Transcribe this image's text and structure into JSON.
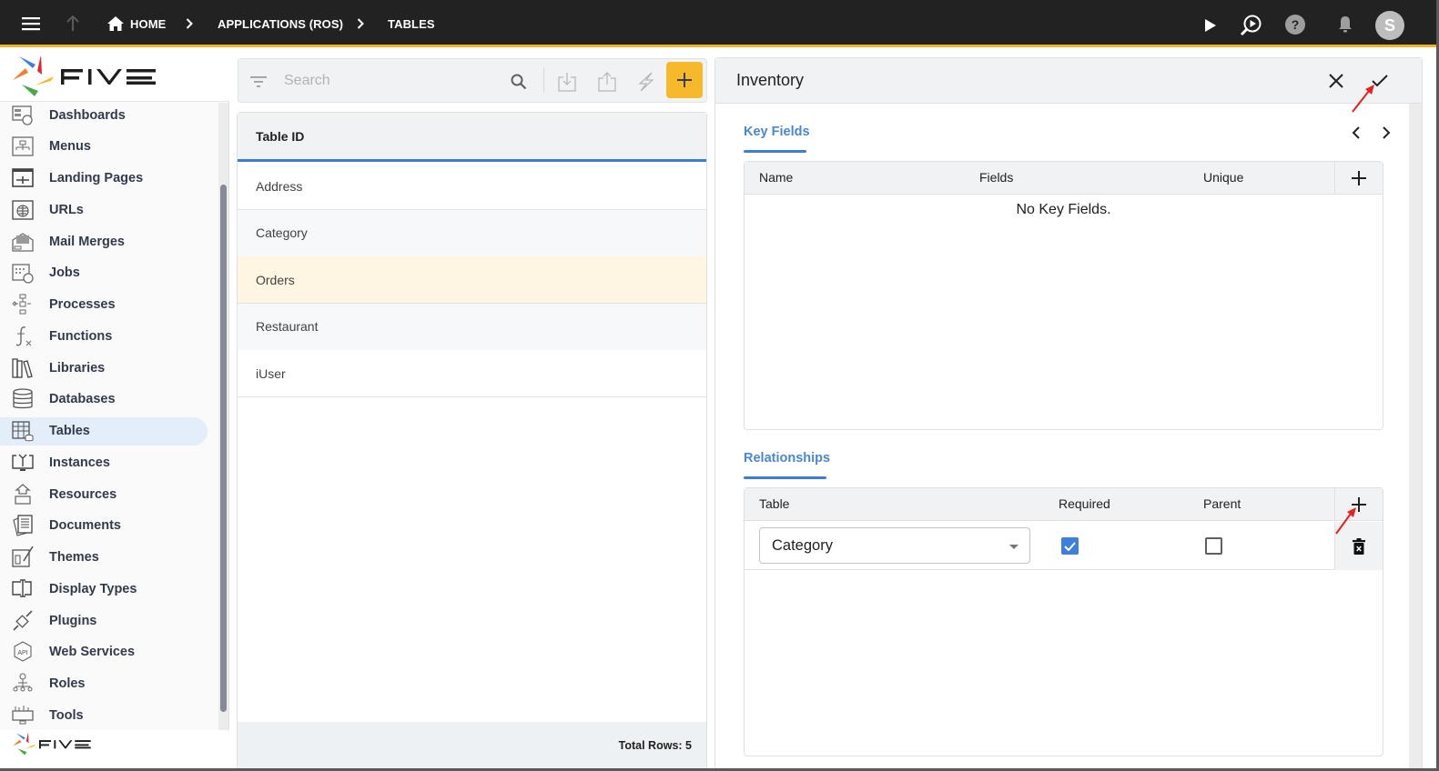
{
  "topbar": {
    "menu_icon": "hamburger-menu-icon",
    "up_icon": "arrow-up-icon",
    "breadcrumbs": [
      {
        "label": "HOME",
        "icon": "home-icon"
      },
      {
        "label": "APPLICATIONS (ROS)"
      },
      {
        "label": "TABLES"
      }
    ],
    "separator_glyph": "›",
    "actions": [
      {
        "name": "run",
        "icon": "play-icon"
      },
      {
        "name": "inspect",
        "icon": "search-play-icon"
      },
      {
        "name": "help",
        "icon": "help-circle-icon"
      },
      {
        "name": "notifications",
        "icon": "bell-icon"
      }
    ],
    "avatar_initial": "S",
    "accent_color": "#f0b323"
  },
  "brand": {
    "wordmark": "FIVE"
  },
  "sidebar": {
    "items": [
      {
        "label": "Dashboards",
        "icon": "dashboard-icon"
      },
      {
        "label": "Menus",
        "icon": "menu-tree-icon"
      },
      {
        "label": "Landing Pages",
        "icon": "landing-page-icon"
      },
      {
        "label": "URLs",
        "icon": "globe-icon"
      },
      {
        "label": "Mail Merges",
        "icon": "mail-merge-icon"
      },
      {
        "label": "Jobs",
        "icon": "calendar-clock-icon"
      },
      {
        "label": "Processes",
        "icon": "process-flow-icon"
      },
      {
        "label": "Functions",
        "icon": "function-icon"
      },
      {
        "label": "Libraries",
        "icon": "books-icon"
      },
      {
        "label": "Databases",
        "icon": "database-icon"
      },
      {
        "label": "Tables",
        "icon": "table-icon",
        "active": true
      },
      {
        "label": "Instances",
        "icon": "instance-monitor-icon"
      },
      {
        "label": "Resources",
        "icon": "resources-icon"
      },
      {
        "label": "Documents",
        "icon": "documents-icon"
      },
      {
        "label": "Themes",
        "icon": "theme-brush-icon"
      },
      {
        "label": "Display Types",
        "icon": "display-type-icon"
      },
      {
        "label": "Plugins",
        "icon": "plugin-icon"
      },
      {
        "label": "Web Services",
        "icon": "api-icon"
      },
      {
        "label": "Roles",
        "icon": "roles-icon"
      },
      {
        "label": "Tools",
        "icon": "tools-icon"
      }
    ]
  },
  "list": {
    "search_placeholder": "Search",
    "toolbar": [
      {
        "name": "filter",
        "icon": "filter-icon"
      },
      {
        "name": "search",
        "icon": "search-icon"
      },
      {
        "name": "import",
        "icon": "download-icon"
      },
      {
        "name": "export",
        "icon": "upload-icon"
      },
      {
        "name": "generate",
        "icon": "lightning-icon"
      },
      {
        "name": "add",
        "icon": "plus-icon"
      }
    ],
    "column_header": "Table ID",
    "rows": [
      {
        "label": "Address"
      },
      {
        "label": "Category"
      },
      {
        "label": "Orders",
        "selected": true
      },
      {
        "label": "Restaurant"
      },
      {
        "label": "iUser"
      }
    ],
    "footer": "Total Rows: 5",
    "add_button_color": "#f6b92b"
  },
  "detail": {
    "title": "Inventory",
    "close_icon": "close-icon",
    "save_icon": "check-icon",
    "nav_prev_icon": "chevron-left-icon",
    "nav_next_icon": "chevron-right-icon",
    "key_fields": {
      "tab_label": "Key Fields",
      "columns": [
        "Name",
        "Fields",
        "Unique"
      ],
      "add_icon": "plus-icon",
      "empty_message": "No Key Fields."
    },
    "relationships": {
      "tab_label": "Relationships",
      "columns": [
        "Table",
        "Required",
        "Parent"
      ],
      "add_icon": "plus-icon",
      "rows": [
        {
          "table": "Category",
          "required": true,
          "parent": false,
          "delete_icon": "trash-icon"
        }
      ]
    },
    "accent_color": "#3b7dd8"
  },
  "annotations": {
    "arrow_color": "#e8201f"
  }
}
